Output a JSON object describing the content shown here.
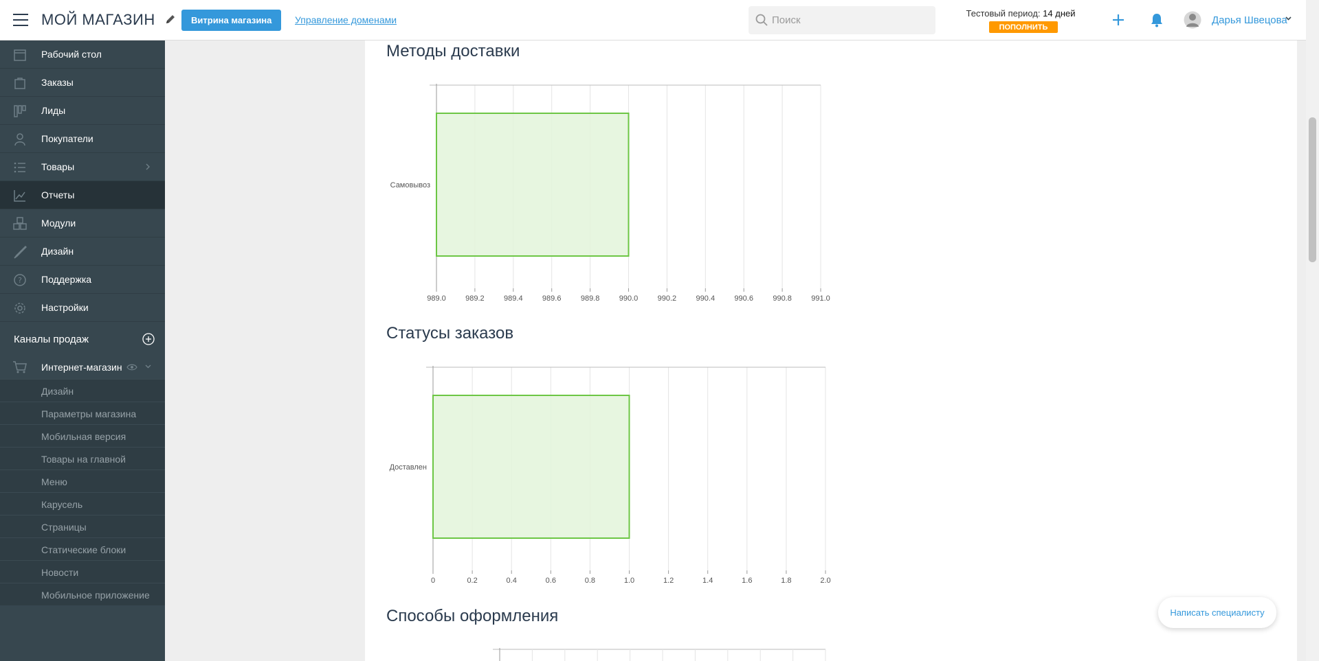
{
  "header": {
    "logo": "МОЙ МАГАЗИН",
    "storefront_button": "Витрина магазина",
    "domains_link": "Управление доменами",
    "search_placeholder": "Поиск",
    "trial_label": "Тестовый период:",
    "trial_days": "14 дней",
    "topup_button": "пополнить",
    "user_name": "Дарья Швецова"
  },
  "sidebar": {
    "items": [
      {
        "label": "Рабочий стол",
        "icon": "calendar-icon"
      },
      {
        "label": "Заказы",
        "icon": "bag-icon"
      },
      {
        "label": "Лиды",
        "icon": "kanban-icon"
      },
      {
        "label": "Покупатели",
        "icon": "user-icon"
      },
      {
        "label": "Товары",
        "icon": "list-icon"
      },
      {
        "label": "Отчеты",
        "icon": "chart-icon"
      },
      {
        "label": "Модули",
        "icon": "cubes-icon"
      },
      {
        "label": "Дизайн",
        "icon": "brush-icon"
      },
      {
        "label": "Поддержка",
        "icon": "question-icon"
      },
      {
        "label": "Настройки",
        "icon": "gear-icon"
      }
    ],
    "active_item": "Отчеты",
    "channels_label": "Каналы продаж",
    "store_label": "Интернет-магазин",
    "sub_items": [
      "Дизайн",
      "Параметры магазина",
      "Мобильная версия",
      "Товары на главной",
      "Меню",
      "Карусель",
      "Страницы",
      "Статические блоки",
      "Новости",
      "Мобильное приложение"
    ]
  },
  "sections": {
    "delivery_title": "Методы доставки",
    "statuses_title": "Статусы заказов",
    "checkout_title": "Способы оформления"
  },
  "chart_data": [
    {
      "type": "bar",
      "orientation": "horizontal",
      "title": "Методы доставки",
      "categories": [
        "Самовывоз"
      ],
      "values": [
        990
      ],
      "xlim": [
        989.0,
        991.0
      ],
      "ticks": [
        "989.0",
        "989.2",
        "989.4",
        "989.6",
        "989.8",
        "990.0",
        "990.2",
        "990.4",
        "990.6",
        "990.8",
        "991.0"
      ],
      "grid": true,
      "bar_fill": "#e3f4da",
      "bar_stroke": "#6cc644"
    },
    {
      "type": "bar",
      "orientation": "horizontal",
      "title": "Статусы заказов",
      "categories": [
        "Доставлен"
      ],
      "values": [
        1
      ],
      "xlim": [
        0,
        2.0
      ],
      "ticks": [
        "0",
        "0.2",
        "0.4",
        "0.6",
        "0.8",
        "1.0",
        "1.2",
        "1.4",
        "1.6",
        "1.8",
        "2.0"
      ],
      "grid": true,
      "bar_fill": "#e3f4da",
      "bar_stroke": "#6cc644"
    }
  ],
  "floating_button": "Написать специалисту",
  "colors": {
    "accent": "#3498db",
    "topup": "#ff9900",
    "sidebar": "#37474f",
    "sidebar_active": "#263238"
  }
}
